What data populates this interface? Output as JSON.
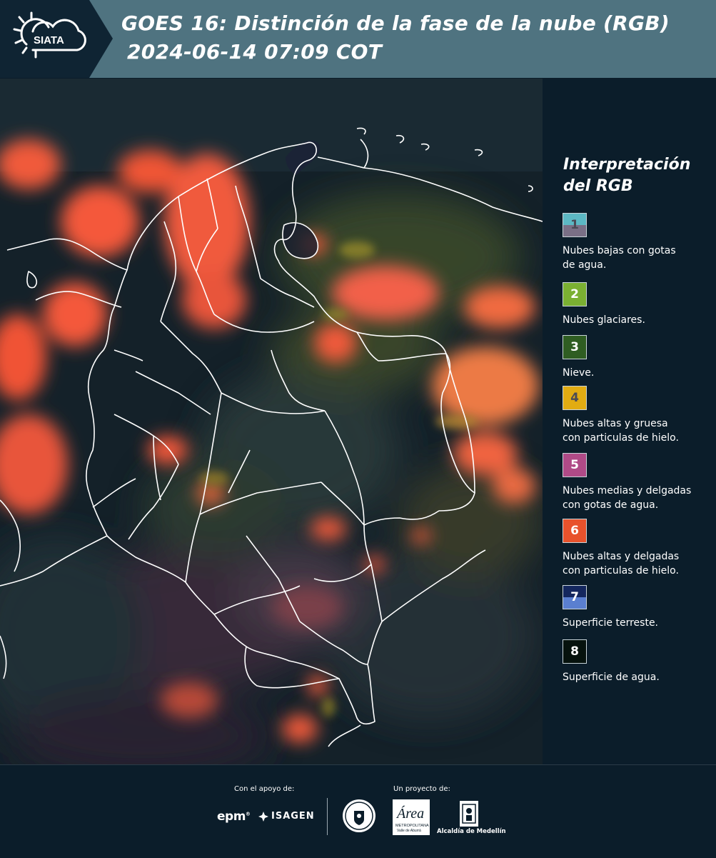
{
  "header": {
    "logo_text": "SIATA",
    "title": "GOES 16: Distinción de la fase de la nube (RGB)",
    "timestamp": "2024-06-14 07:09 COT",
    "background_color": "#4f7380"
  },
  "map": {
    "type": "satellite RGB composite",
    "region": "Colombia",
    "icon": "map-of-colombia"
  },
  "legend": {
    "title_line1": "Interpretación",
    "title_line2": "del RGB",
    "items": [
      {
        "number": "1",
        "label": "Nubes bajas con gotas de agua.",
        "line1": "Nubes bajas con gotas",
        "line2": "de agua.",
        "color_top": "#5cb8c4",
        "color_bottom": "#7a6f86",
        "num_color": "#4a4a55"
      },
      {
        "number": "2",
        "label": "Nubes glaciares.",
        "line1": "Nubes glaciares.",
        "line2": "",
        "color_top": "#7bb032",
        "color_bottom": "#7bb032",
        "num_color": "#ffffff"
      },
      {
        "number": "3",
        "label": "Nieve.",
        "line1": "Nieve.",
        "line2": "",
        "color_top": "#2f5d22",
        "color_bottom": "#2f5d22",
        "num_color": "#ffffff"
      },
      {
        "number": "4",
        "label": "Nubes altas y gruesa con particulas de hielo.",
        "line1": "Nubes altas y gruesa",
        "line2": "con particulas de hielo.",
        "color_top": "#e2ac12",
        "color_bottom": "#e2ac12",
        "num_color": "#4a4a55"
      },
      {
        "number": "5",
        "label": "Nubes medias y delgadas con gotas de agua.",
        "line1": "Nubes medias y delgadas",
        "line2": "con gotas de agua.",
        "color_top": "#b04a87",
        "color_bottom": "#b04a87",
        "num_color": "#ffffff"
      },
      {
        "number": "6",
        "label": "Nubes altas y delgadas con particulas de hielo.",
        "line1": "Nubes altas y delgadas",
        "line2": "con particulas de hielo.",
        "color_top": "#e8522c",
        "color_bottom": "#e8522c",
        "num_color": "#ffffff"
      },
      {
        "number": "7",
        "label": "Superficie terreste.",
        "line1": "Superficie terreste.",
        "line2": "",
        "color_top": "#14275e",
        "color_bottom": "#5a7fd0",
        "num_color": "#ffffff"
      },
      {
        "number": "8",
        "label": "Superficie de agua.",
        "line1": "Superficie de agua.",
        "line2": "",
        "color_top": "#06120d",
        "color_bottom": "#06120d",
        "num_color": "#ffffff"
      }
    ]
  },
  "footer": {
    "support_label": "Con el apoyo de:",
    "project_label": "Un proyecto de:",
    "epm": "epm",
    "isagen": "ISAGEN",
    "area_logo_text": "Área",
    "area_logo_sub": "METROPOLITANA",
    "area_logo_sub2": "Valle de Aburrá",
    "medellin": "Alcaldía de Medellín"
  }
}
